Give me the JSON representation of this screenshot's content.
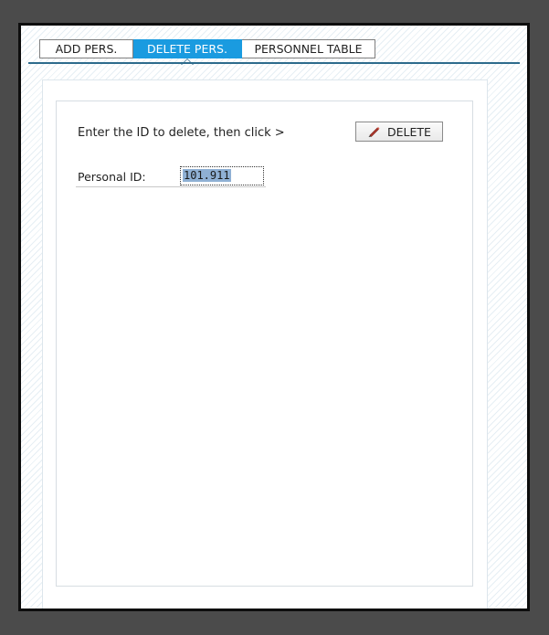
{
  "tabs": [
    {
      "label": "ADD PERS.",
      "active": false
    },
    {
      "label": "DELETE PERS.",
      "active": true
    },
    {
      "label": "PERSONNEL TABLE",
      "active": false
    }
  ],
  "form": {
    "instruction": "Enter the ID to delete, then click >",
    "delete_button_label": "DELETE",
    "delete_button_icon": "pen-icon",
    "id_label": "Personal ID:",
    "id_value": "101.911"
  },
  "colors": {
    "active_tab": "#1a9be0",
    "rule": "#2d6b8c",
    "selection": "#8fb0d4"
  }
}
